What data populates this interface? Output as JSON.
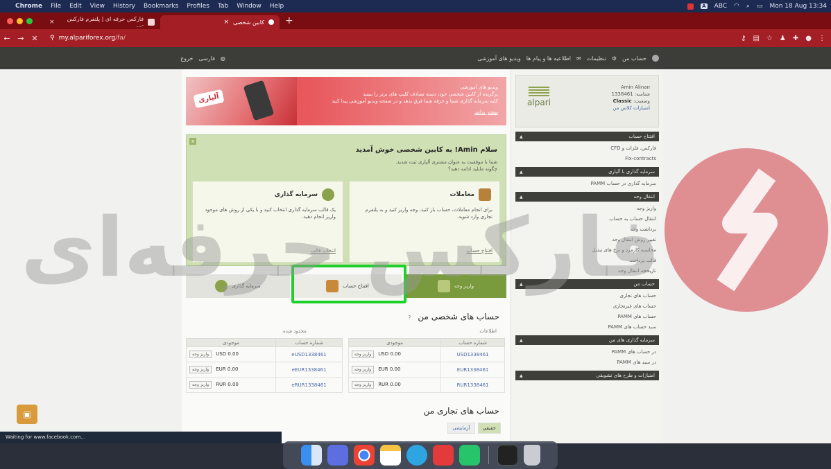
{
  "menubar": {
    "apple": "",
    "items": [
      "Chrome",
      "File",
      "Edit",
      "View",
      "History",
      "Bookmarks",
      "Profiles",
      "Tab",
      "Window",
      "Help"
    ],
    "abc": "ABC",
    "clock": "Mon 18 Aug 13:34"
  },
  "browser": {
    "tabs": [
      {
        "title": "فارکس حرفه ای | پلتفرم فارکس -...",
        "active": false
      },
      {
        "title": "کابین شخصی",
        "active": true
      }
    ],
    "new_tab": "+",
    "url_host": "my.alpariforex.org",
    "url_path": "/fa/",
    "status_text": "Waiting for www.facebook.com..."
  },
  "sitenav": {
    "left": [
      "خروج",
      "فارسی"
    ],
    "right": [
      "حساب من",
      "تنظیمات",
      "اطلاعیه ها و پیام ها",
      "ویدیو های آموزشی"
    ]
  },
  "banner": {
    "line1": "ویدیو های آموزشی",
    "line2": "برگزیده از کابین شخصی خود، دسته تصادف کلیپ های برتر را ببینید",
    "line3": "کلیه سرمایه گذاری شما و حرفه شما فرق بدهد و در صفحه ویدیو آموزشی پیدا کنید",
    "more": "بیشتر بدانید",
    "logo": "آلپاری"
  },
  "welcome": {
    "title": "سلام Amin! به کابین شخصی خوش آمدید",
    "p1": "شما با موفقیت به عنوان مشتری آلپاری ثبت شدید.",
    "p2": "چگونه مایلید ادامه دهید؟",
    "close": "x",
    "trade": {
      "title": "معاملات",
      "desc": "برای انجام معاملات، حساب باز کنید، وجه واریز کنید و به پلتفرم تجاری وارد شوید.",
      "link": "افتتاح حساب"
    },
    "invest": {
      "title": "سرمایه گذاری",
      "desc": "یک قالب سرمایه گذاری انتخاب کنید و با یکی از روش های موجود واریز انجام دهید.",
      "link": "انتخاب قالب"
    }
  },
  "tiles": {
    "deposit": "واریز وجه",
    "open_account": "افتتاح حساب",
    "invest": "سرمایه گذاری"
  },
  "accounts": {
    "title": "حساب های شخصی من",
    "help": "?",
    "left_sub": "محدود شده",
    "right_sub": "اطلاعات",
    "col_account": "شماره حساب",
    "col_balance": "موجودی",
    "deposit_btn": "واریز وجه",
    "left_rows": [
      {
        "num": "eUSD1338461",
        "bal": "USD 0.00"
      },
      {
        "num": "eEUR1338461",
        "bal": "EUR 0.00"
      },
      {
        "num": "eRUR1338461",
        "bal": "RUR 0.00"
      }
    ],
    "right_rows": [
      {
        "num": "USD1338461",
        "bal": "USD 0.00"
      },
      {
        "num": "EUR1338461",
        "bal": "EUR 0.00"
      },
      {
        "num": "RUR1338461",
        "bal": "RUR 0.00"
      }
    ]
  },
  "trading": {
    "title": "حساب های تجاری من",
    "tabs": [
      "حقیقی",
      "آزمایشی"
    ]
  },
  "sidebar": {
    "profile": {
      "name": "Amin Alinan",
      "id": "شناسه: 1338461",
      "status_label": "وضعیت:",
      "status": "Classic",
      "link": "امتیازات کلاس من",
      "logo": "alpari"
    },
    "sections": [
      {
        "header": "افتتاح حساب",
        "items": [
          "فارکس، فلزات و CFD",
          "Fix-contracts"
        ]
      },
      {
        "header": "سرمایه گذاری با آلپاری",
        "items": [
          "سرمایه گذاری در حساب PAMM"
        ]
      },
      {
        "header": "انتقال وجه",
        "items": [
          "واریز وجه",
          "انتقال حساب به حساب",
          "برداشت وجه",
          "تغییر روش انتقال وجه",
          "محاسبه کارمزد و نرخ های تبدیل",
          "قالب پرداخت",
          "تاریخچه انتقال وجه"
        ]
      },
      {
        "header": "حساب من",
        "items": [
          "حساب های تجاری",
          "حساب های غیرتجاری",
          "حساب های PAMM",
          "سبد حساب های PAMM"
        ]
      },
      {
        "header": "سرمایه گذاری های من",
        "items": [
          "در حساب های PAMM",
          "در سبد های PAMM"
        ]
      },
      {
        "header": "امتیازات و طرح های تشویقی",
        "items": []
      }
    ]
  },
  "watermark": {
    "text": "فارکس حرفه‌ای"
  },
  "colors": {
    "browser_red": "#a41e25",
    "site_green": "#7a9b3d",
    "highlight": "#1ed02c"
  }
}
